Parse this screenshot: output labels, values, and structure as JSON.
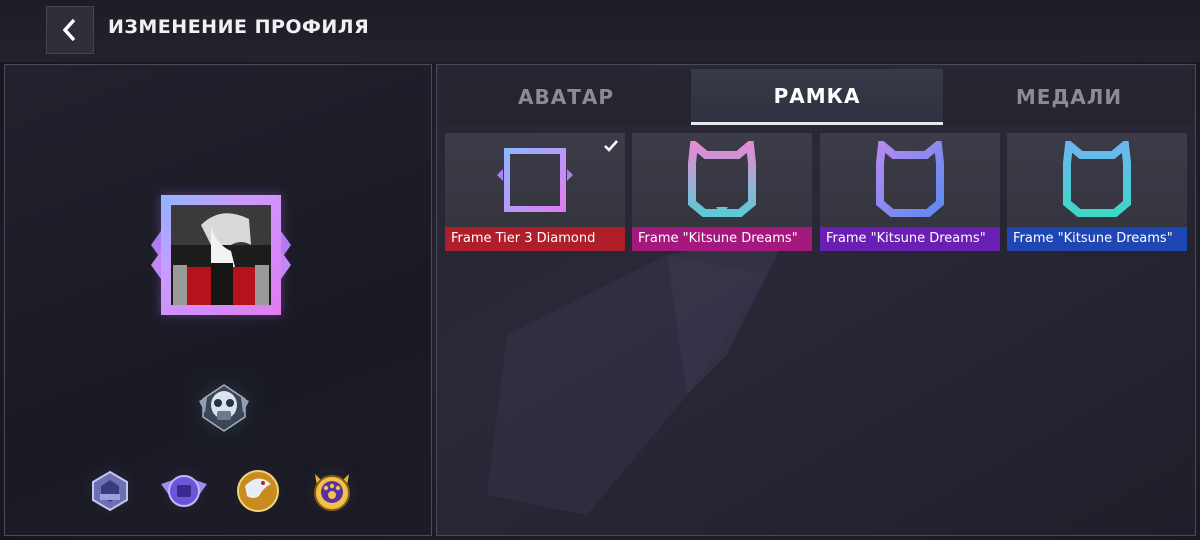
{
  "header": {
    "title": "ИЗМЕНЕНИЕ ПРОФИЛЯ",
    "back_icon": "chevron-left-icon"
  },
  "tabs": [
    {
      "label": "АВАТАР",
      "active": false
    },
    {
      "label": "РАМКА",
      "active": true
    },
    {
      "label": "МЕДАЛИ",
      "active": false
    }
  ],
  "frames": [
    {
      "label": "Frame Tier 3 Diamond",
      "color": "#b01e2a",
      "selected": true
    },
    {
      "label": "Frame \"Kitsune Dreams\"",
      "color": "#a5197f",
      "selected": false
    },
    {
      "label": "Frame \"Kitsune Dreams\"",
      "color": "#6a1eb3",
      "selected": false
    },
    {
      "label": "Frame \"Kitsune Dreams\"",
      "color": "#1f47b3",
      "selected": false
    }
  ],
  "profile": {
    "frame_colors": [
      "#8fb6ff",
      "#e07cf0"
    ],
    "main_medal_icon": "skull-gasmask-emblem-icon",
    "medals": [
      "silver-2024-badge-icon",
      "purple-winged-badge-icon",
      "gold-dragon-badge-icon",
      "gold-cat-paw-badge-icon"
    ]
  },
  "colors": {
    "accent": "#e8e8ee",
    "panel_border": "#4a4a58"
  }
}
